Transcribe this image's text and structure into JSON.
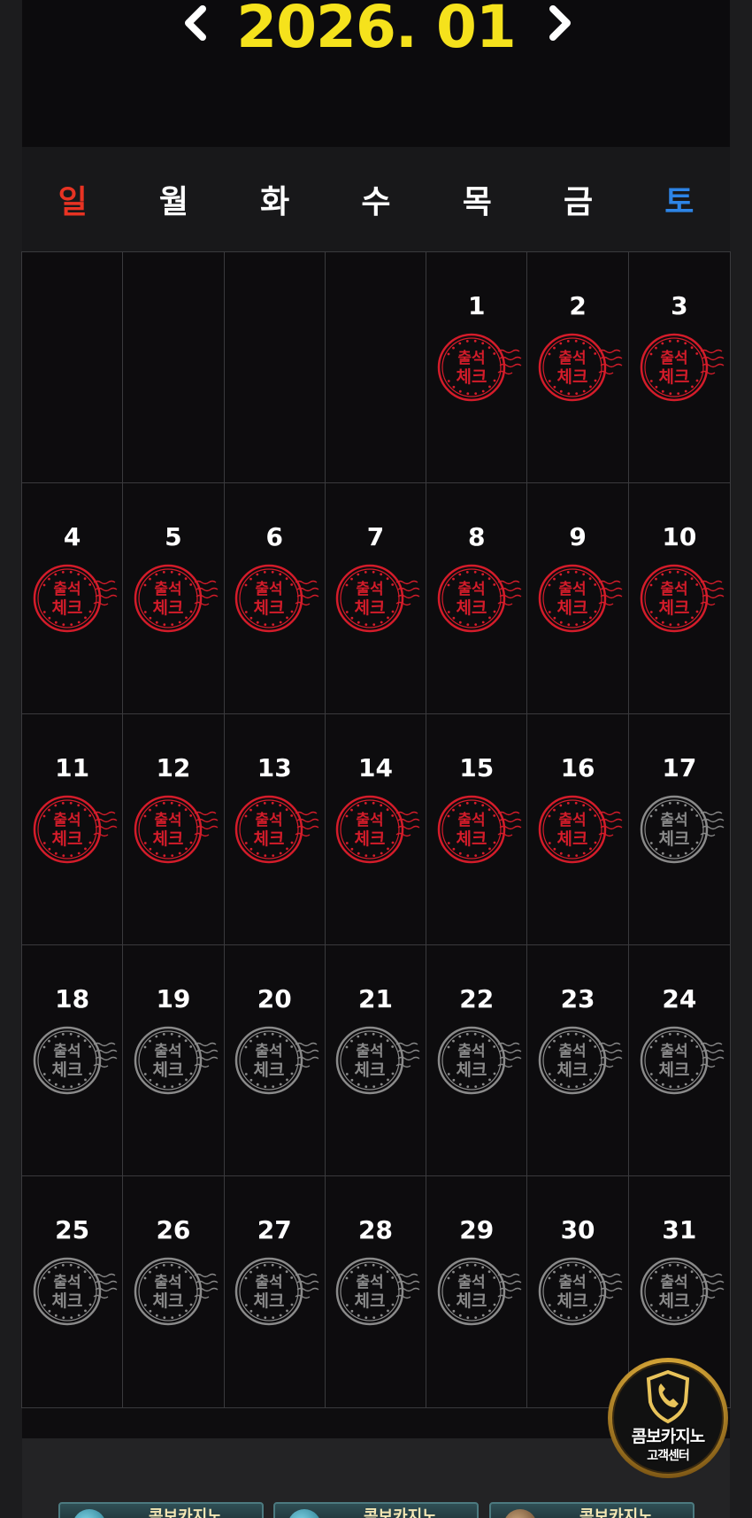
{
  "calendar": {
    "year": 2026,
    "month_label": "2026. 01",
    "weekdays": [
      "일",
      "월",
      "화",
      "수",
      "목",
      "금",
      "토"
    ],
    "leading_blanks": 4,
    "days_in_month": 31,
    "checked_through_day": 16,
    "stamp_text_top": "출석",
    "stamp_text_bottom": "체크",
    "colors": {
      "title": "#f5e21c",
      "sunday": "#e83323",
      "saturday": "#2d84e6",
      "stamp_checked": "#d41c2a",
      "stamp_unchecked": "#8a8a8a"
    }
  },
  "nav": {
    "prev_icon": "chevron-left-icon",
    "next_icon": "chevron-right-icon"
  },
  "support_badge": {
    "line1": "콤보카지노",
    "line2": "고객센터",
    "icon": "shield-phone-icon"
  },
  "banners": [
    {
      "label": "콤보카지노"
    },
    {
      "label": "콤보카지노"
    },
    {
      "label": "콤보카지노"
    }
  ]
}
